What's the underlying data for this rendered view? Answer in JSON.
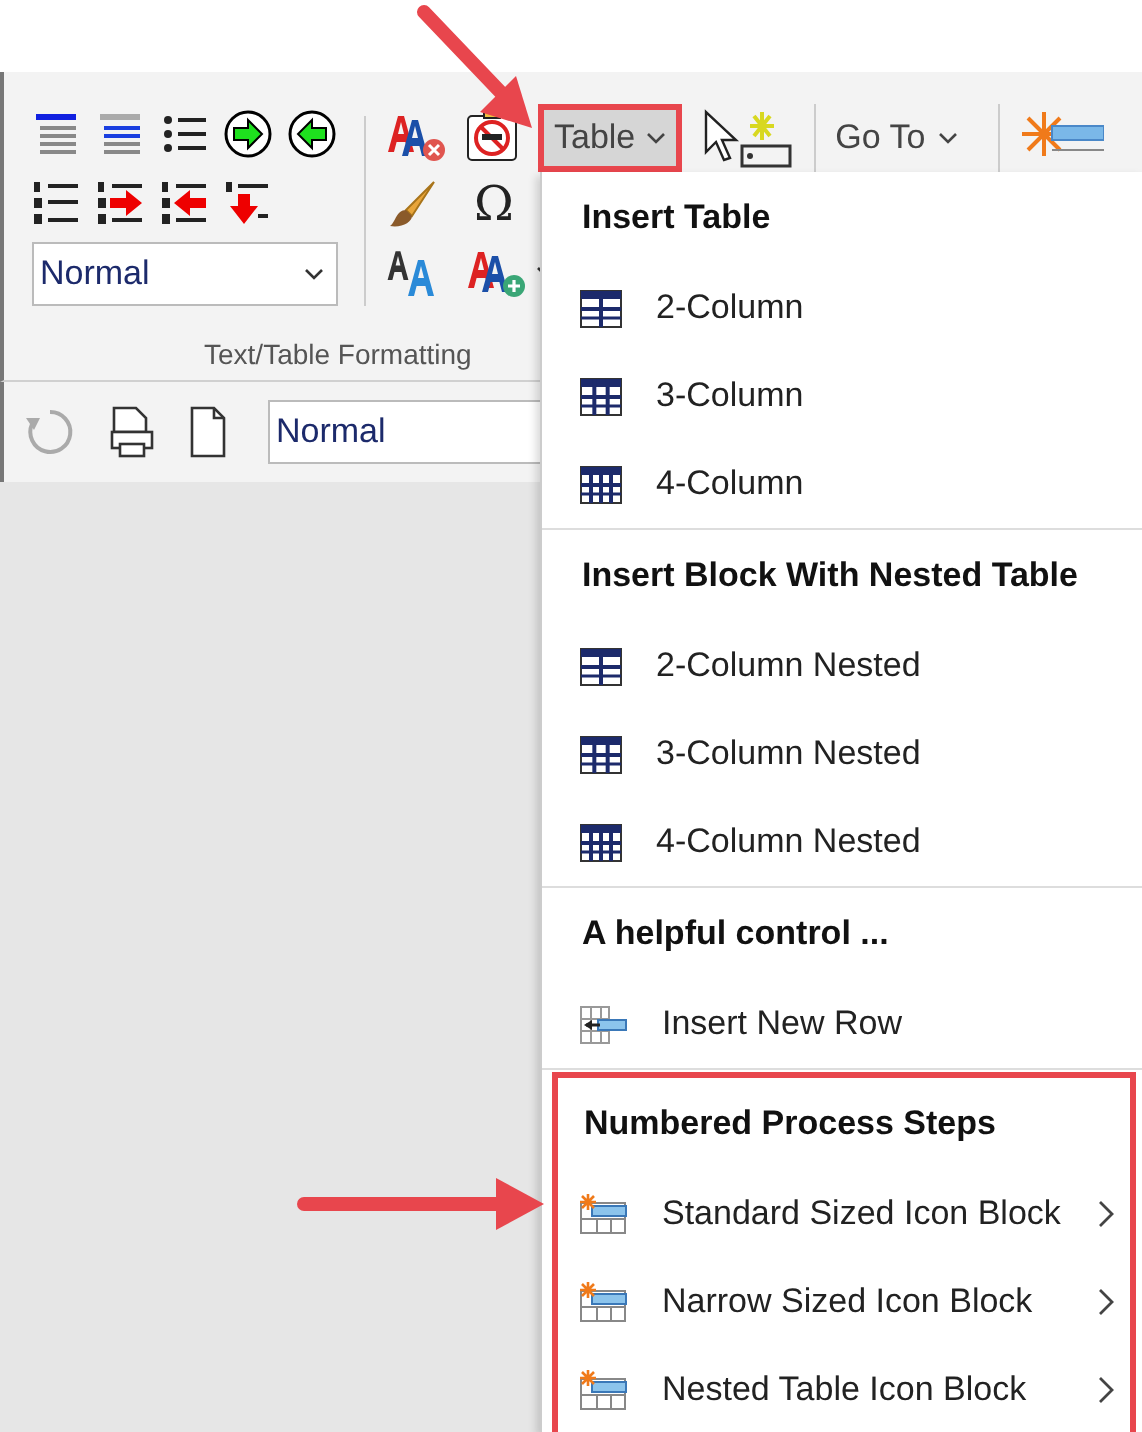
{
  "ribbon": {
    "style_select": {
      "value": "Normal"
    },
    "symbol_button": {
      "label": "Ω"
    },
    "group_label": "Text/Table Formatting",
    "table_button": {
      "label": "Table",
      "expanded": true,
      "highlighted": true
    },
    "goto_button": {
      "label": "Go To"
    }
  },
  "quick_bar": {
    "style_field": {
      "value": "Normal"
    }
  },
  "menu": {
    "sections": [
      {
        "heading": "Insert Table",
        "highlighted": false,
        "items": [
          {
            "label": "2-Column",
            "kind": "table2",
            "submenu": false
          },
          {
            "label": "3-Column",
            "kind": "table3",
            "submenu": false
          },
          {
            "label": "4-Column",
            "kind": "table4",
            "submenu": false
          }
        ]
      },
      {
        "heading": "Insert Block With Nested Table",
        "highlighted": false,
        "items": [
          {
            "label": "2-Column Nested",
            "kind": "table2",
            "submenu": false
          },
          {
            "label": "3-Column Nested",
            "kind": "table3",
            "submenu": false
          },
          {
            "label": "4-Column Nested",
            "kind": "table4",
            "submenu": false
          }
        ]
      },
      {
        "heading": "A helpful control ...",
        "highlighted": false,
        "items": [
          {
            "label": "Insert New Row",
            "kind": "insert-row",
            "submenu": false
          }
        ]
      },
      {
        "heading": "Numbered Process Steps",
        "highlighted": true,
        "items": [
          {
            "label": "Standard Sized Icon Block",
            "kind": "process",
            "submenu": true
          },
          {
            "label": "Narrow Sized Icon Block",
            "kind": "process",
            "submenu": true
          },
          {
            "label": "Nested Table Icon Block",
            "kind": "process",
            "submenu": true
          }
        ]
      }
    ]
  }
}
